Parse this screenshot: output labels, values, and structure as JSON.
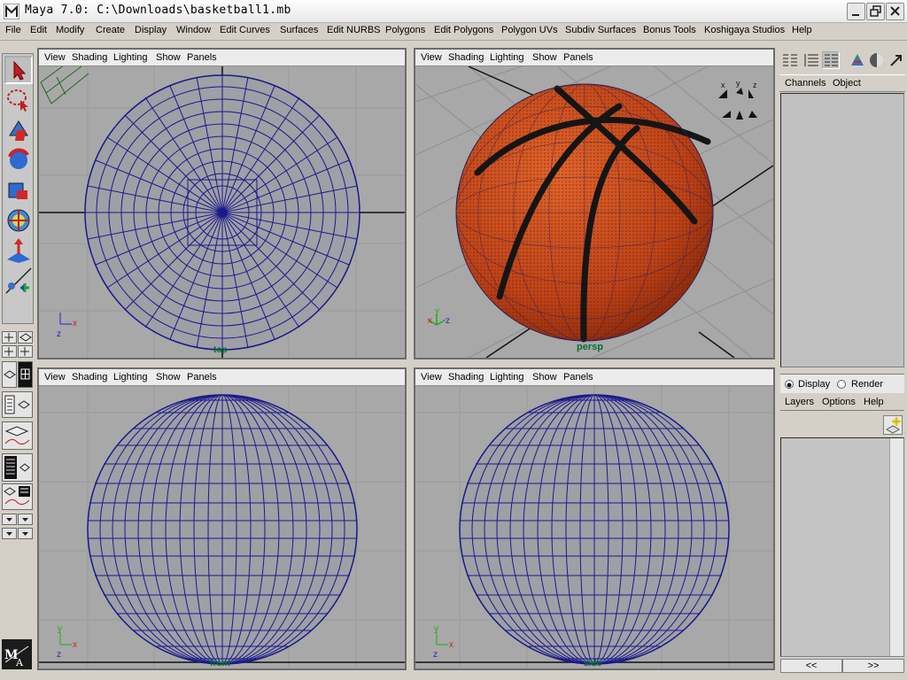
{
  "window": {
    "title": "Maya 7.0: C:\\Downloads\\basketball1.mb"
  },
  "menubar": {
    "items": [
      "File",
      "Edit",
      "Modify",
      "Create",
      "Display",
      "Window",
      "Edit Curves",
      "Surfaces",
      "Edit NURBS",
      "Polygons",
      "Edit Polygons",
      "Polygon UVs",
      "Subdiv Surfaces",
      "Bonus Tools",
      "Koshigaya Studios",
      "Help"
    ]
  },
  "viewport_menu": {
    "items": [
      "View",
      "Shading",
      "Lighting",
      "Show",
      "Panels"
    ]
  },
  "viewports": {
    "top_left": {
      "camera": "top"
    },
    "top_right": {
      "camera": "persp"
    },
    "bottom_left": {
      "camera": "front"
    },
    "bottom_right": {
      "camera": "side"
    }
  },
  "axis_labels": {
    "x": "x",
    "y": "y",
    "z": "z"
  },
  "channel_box": {
    "tabs": [
      "Channels",
      "Object"
    ]
  },
  "layer_editor": {
    "radio_display": "Display",
    "radio_render": "Render",
    "selected": "Display",
    "menu": [
      "Layers",
      "Options",
      "Help"
    ]
  },
  "scroll_arrows": {
    "left": "<<",
    "right": ">>"
  },
  "colors": {
    "wire": "#1a1a8a",
    "ball": "#c24a1e",
    "seam": "#151515",
    "viewport_bg": "#a8a8a8",
    "cam_label": "#00702a"
  }
}
